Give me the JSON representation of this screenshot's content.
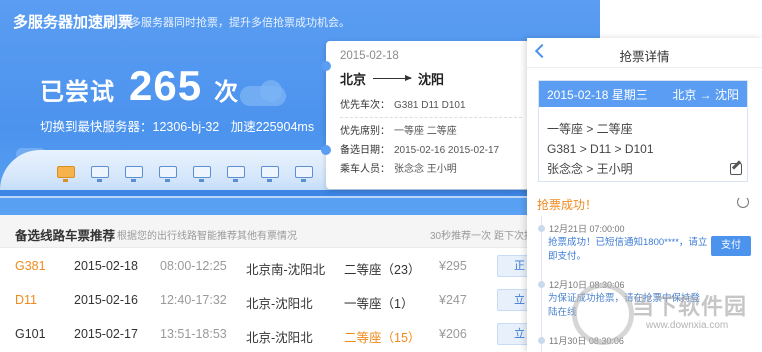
{
  "hero": {
    "title": "多服务器加速刷票",
    "subtitle": "多服务器同时抢票，提升多倍抢票成功机会。",
    "attempt_prefix": "已尝试",
    "attempt_count": "265",
    "attempt_suffix": "次",
    "server_label": "切换到最快服务器：12306-bj-32",
    "accel_label": "加速225904ms"
  },
  "ticket": {
    "date": "2015-02-18",
    "from": "北京",
    "to": "沈阳",
    "train_key": "优先车次：",
    "train_val": "G381   D11   D101",
    "seat_key": "优先席别：",
    "seat_val": "一等座   二等座",
    "alt_key": "备选日期：",
    "alt_val": "2015-02-16    2015-02-17",
    "passenger_key": "乘车人员：",
    "passenger_val": "张念念   王小明"
  },
  "recommend": {
    "title": "备选线路车票推荐",
    "subtitle": "根据您的出行线路智能推荐其他有票情况",
    "timer": "30秒推荐一次",
    "next": "距下次推",
    "rows": [
      {
        "train": "G381",
        "date": "2015-02-18",
        "time": "08:00-12:25",
        "station": "北京南-沈阳北",
        "seat": "二等座（23）",
        "price": "¥295",
        "action": "正"
      },
      {
        "train": "D11",
        "date": "2015-02-16",
        "time": "12:40-17:32",
        "station": "北京-沈阳北",
        "seat": "一等座（1）",
        "price": "¥247",
        "action": "立"
      },
      {
        "train": "G101",
        "date": "2015-02-17",
        "time": "13:51-18:53",
        "station": "北京-沈阳北",
        "seat": "二等座（15）",
        "price": "¥206",
        "action": "立"
      }
    ]
  },
  "panel": {
    "title": "抢票详情",
    "card_date": "2015-02-18 星期三",
    "card_route": "北京 → 沈阳",
    "card_seats": "一等座 > 二等座",
    "card_trains": "G381 > D11 > D101",
    "card_passengers": "张念念 > 王小明",
    "success_label": "抢票成功！",
    "logs": [
      {
        "time": "12月21日  07:00:00",
        "text": "抢票成功！已短信通知1800****，请立即支付。"
      },
      {
        "time": "12月10日  08:30:06",
        "text": "为保证成功抢票，请在抢票中保持登陆在线"
      },
      {
        "time": "11月30日  08:30:06",
        "text": ""
      }
    ],
    "pay_label": "支付"
  },
  "watermark": {
    "text": "当下软件园",
    "url": "www.downxia.com"
  }
}
